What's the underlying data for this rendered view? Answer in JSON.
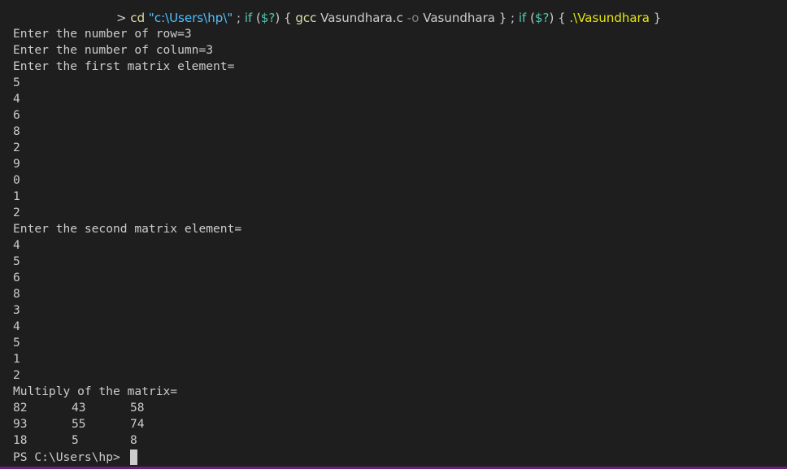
{
  "command": {
    "prompt_char": ">",
    "parts": [
      {
        "text": "cd",
        "cls": "c-cmd"
      },
      {
        "text": " ",
        "cls": "c-plain"
      },
      {
        "text": "\"c:\\Users\\hp\\\"",
        "cls": "c-str"
      },
      {
        "text": " ; ",
        "cls": "c-plain"
      },
      {
        "text": "if",
        "cls": "c-kw"
      },
      {
        "text": " (",
        "cls": "c-plain"
      },
      {
        "text": "$?",
        "cls": "c-kw"
      },
      {
        "text": ") { ",
        "cls": "c-plain"
      },
      {
        "text": "gcc",
        "cls": "c-cmd"
      },
      {
        "text": " Vasundhara.c ",
        "cls": "c-plain"
      },
      {
        "text": "-o",
        "cls": "c-flag"
      },
      {
        "text": " Vasundhara } ; ",
        "cls": "c-plain"
      },
      {
        "text": "if",
        "cls": "c-kw"
      },
      {
        "text": " (",
        "cls": "c-plain"
      },
      {
        "text": "$?",
        "cls": "c-kw"
      },
      {
        "text": ") { ",
        "cls": "c-plain"
      },
      {
        "text": ".\\Vasundhara",
        "cls": "c-exe"
      },
      {
        "text": " }",
        "cls": "c-plain"
      }
    ]
  },
  "output_lines": [
    "Enter the number of row=3",
    "Enter the number of column=3",
    "Enter the first matrix element=",
    "5",
    "4",
    "6",
    "8",
    "2",
    "9",
    "0",
    "1",
    "2",
    "Enter the second matrix element=",
    "4",
    "5",
    "6",
    "8",
    "3",
    "4",
    "5",
    "1",
    "2",
    "Multiply of the matrix="
  ],
  "result_matrix": [
    [
      "82",
      "43",
      "58"
    ],
    [
      "93",
      "55",
      "74"
    ],
    [
      "18",
      "5",
      "8"
    ]
  ],
  "final_prompt": "PS C:\\Users\\hp>",
  "colors": {
    "background": "#1e1e1e",
    "text": "#cccccc",
    "panel_border": "#68217a"
  }
}
